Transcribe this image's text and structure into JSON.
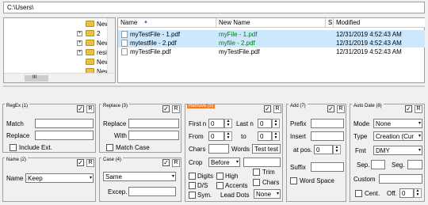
{
  "path": "C:\\Users\\",
  "tree": {
    "items": [
      {
        "label": "New fol",
        "exp": ""
      },
      {
        "label": "2",
        "exp": "+"
      },
      {
        "label": "New",
        "exp": "+"
      },
      {
        "label": "resi",
        "exp": "+"
      },
      {
        "label": "New fol",
        "exp": ""
      },
      {
        "label": "New fol",
        "exp": ""
      },
      {
        "label": "New fol",
        "exp": ""
      }
    ],
    "scroll_grip": "III"
  },
  "columns": {
    "name": "Name",
    "sort": "▲",
    "new_name": "New Name",
    "s": "S",
    "modified": "Modified"
  },
  "files": [
    {
      "name": "myTestFile - 1.pdf",
      "new_name": "myFile - 1.pdf",
      "modified": "12/31/2019 4:52:43 AM"
    },
    {
      "name": "mytestfile - 2.pdf",
      "new_name": "myfile - 2.pdf",
      "modified": "12/31/2019 4:52:43 AM"
    },
    {
      "name": "myTestFile.pdf",
      "new_name": "myTestFile.pdf",
      "modified": "12/31/2019 4:52:43 AM"
    }
  ],
  "colors": {
    "new_name_changed": "#008000",
    "remove_title": "#f47b20",
    "selection": "#cce8ff"
  },
  "regex": {
    "title": "RegEx (1)",
    "match": "Match",
    "replace": "Replace",
    "include_ext": "Include Ext."
  },
  "replace": {
    "title": "Replace (3)",
    "replace": "Replace",
    "with": "With",
    "match_case": "Match Case"
  },
  "remove": {
    "title": "Remove (5)",
    "first_n": "First n",
    "first_n_val": "0",
    "last_n": "Last n",
    "last_n_val": "0",
    "from": "From",
    "from_val": "0",
    "to": "to",
    "to_val": "0",
    "chars": "Chars",
    "words": "Words",
    "words_val": "Test test",
    "crop": "Crop",
    "crop_val": "Before",
    "digits": "Digits",
    "high": "High",
    "trim": "Trim",
    "ds": "D/S",
    "accents": "Accents",
    "chars2": "Chars",
    "sym": "Sym.",
    "lead_dots": "Lead Dots",
    "lead_val": "None"
  },
  "add": {
    "title": "Add (7)",
    "prefix": "Prefix",
    "insert": "Insert",
    "at_pos": "at pos.",
    "at_pos_val": "0",
    "suffix": "Suffix",
    "word_space": "Word Space"
  },
  "autodate": {
    "title": "Auto Date (8)",
    "mode": "Mode",
    "mode_val": "None",
    "type": "Type",
    "type_val": "Creation (Cur",
    "fmt": "Fmt",
    "fmt_val": "DMY",
    "sep": "Sep.",
    "seg": "Seg.",
    "custom": "Custom",
    "cent": "Cent.",
    "off": "Off.",
    "off_val": "0"
  },
  "name_panel": {
    "title": "Name (2)",
    "name": "Name",
    "val": "Keep"
  },
  "case_panel": {
    "title": "Case (4)",
    "val": "Same",
    "except": "Excep."
  },
  "r": "R",
  "check": "✓",
  "arrow": "▾",
  "up": "▲",
  "down": "▼"
}
